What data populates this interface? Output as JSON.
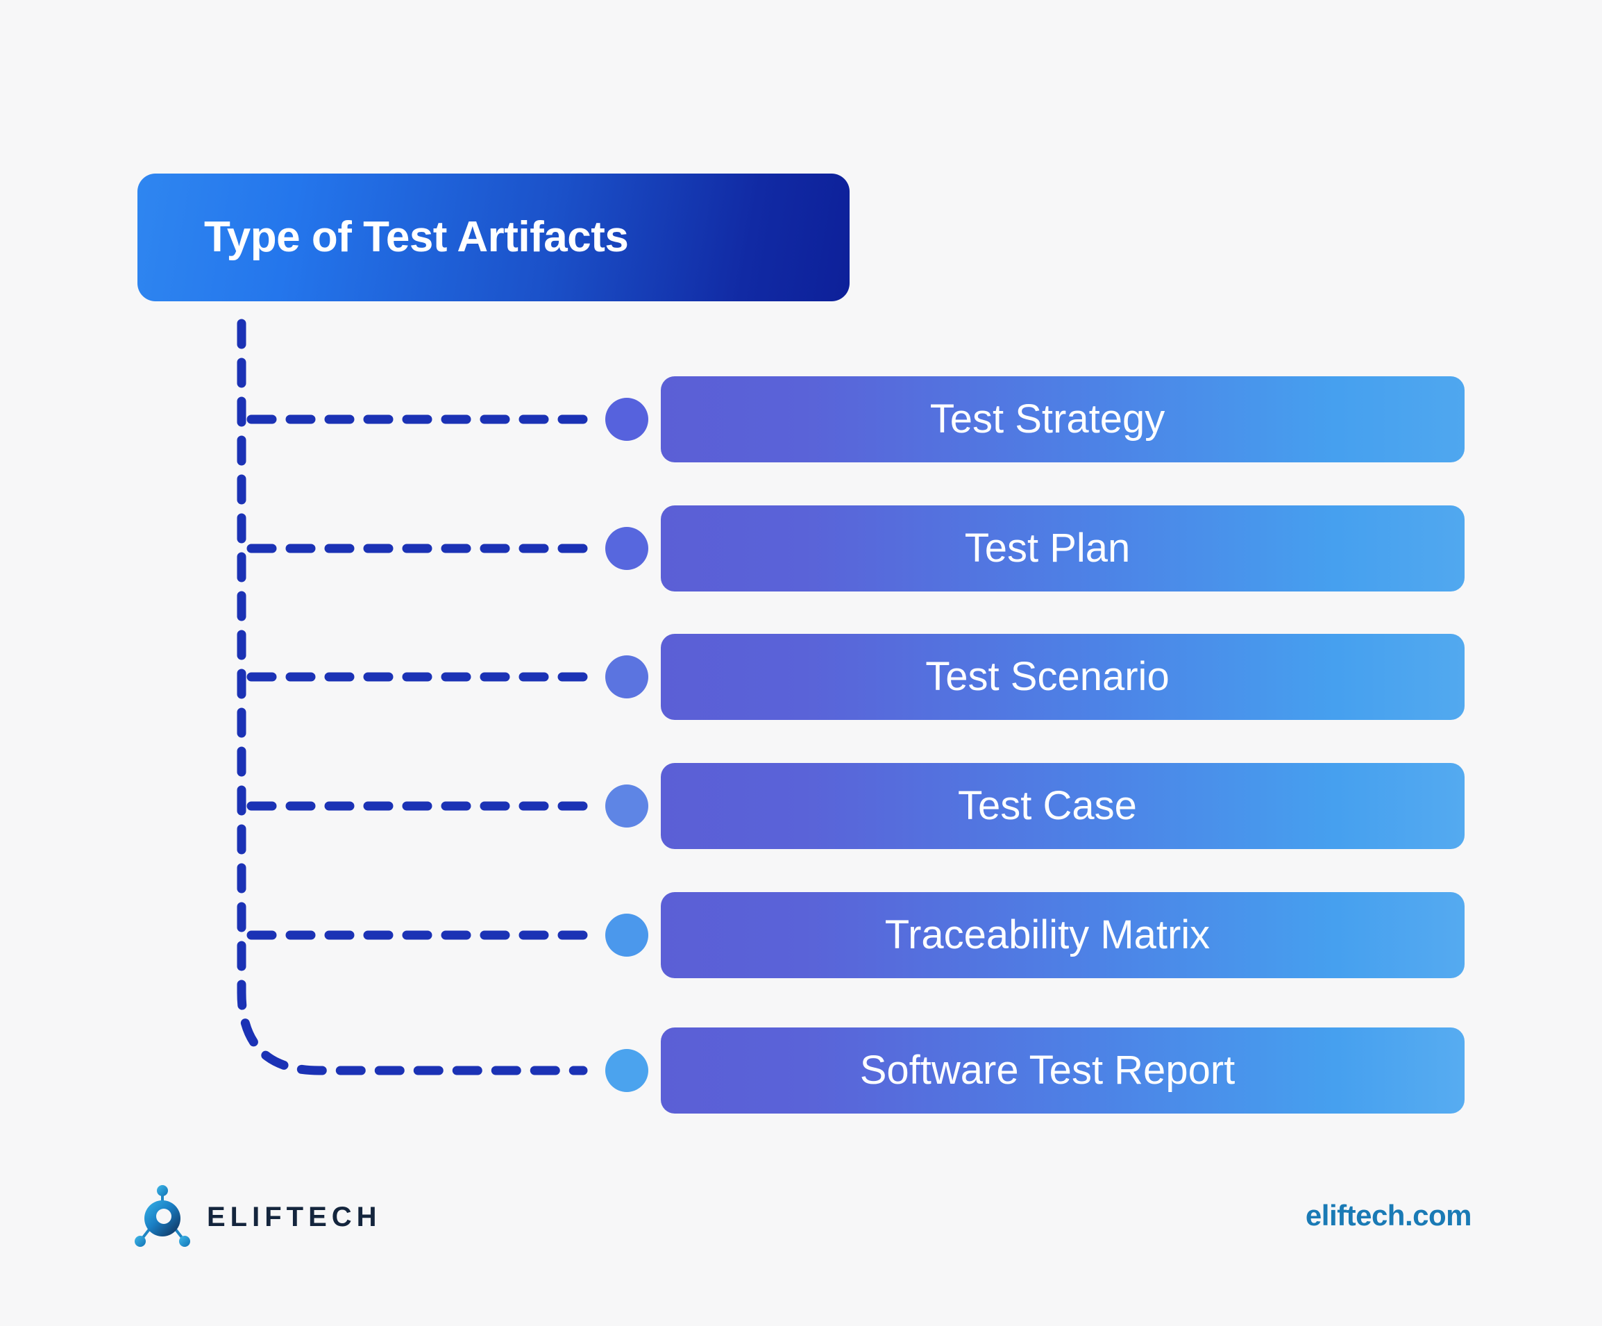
{
  "background_color": "#f7f7f8",
  "header": {
    "title": "Type of Test Artifacts",
    "gradient_from": "#2f86f0",
    "gradient_to": "#0d2099"
  },
  "connector": {
    "color": "#1b32b5",
    "style": "dashed",
    "icon": "dashed-connector-line"
  },
  "items": [
    {
      "label": "Test Strategy",
      "dot_color": "#5662dd",
      "bar_from": "#5b5fd6",
      "bar_to": "#4fa7ef"
    },
    {
      "label": "Test Plan",
      "dot_color": "#5767de",
      "bar_from": "#5b5fd6",
      "bar_to": "#51a8ef"
    },
    {
      "label": "Test Scenario",
      "dot_color": "#5b74e0",
      "bar_from": "#5b5fd6",
      "bar_to": "#52a9ef"
    },
    {
      "label": "Test Case",
      "dot_color": "#5e85e5",
      "bar_from": "#5b5fd6",
      "bar_to": "#54aaf0"
    },
    {
      "label": "Traceability Matrix",
      "dot_color": "#4b98ec",
      "bar_from": "#5b5fd6",
      "bar_to": "#55aaf0"
    },
    {
      "label": "Software Test Report",
      "dot_color": "#4ba3ee",
      "bar_from": "#5b5fd6",
      "bar_to": "#57acf1"
    }
  ],
  "footer": {
    "logo_icon": "eliftech-molecule-logo",
    "brand": "ELIFTECH",
    "website": "eliftech.com",
    "website_color": "#1a7ab5"
  }
}
